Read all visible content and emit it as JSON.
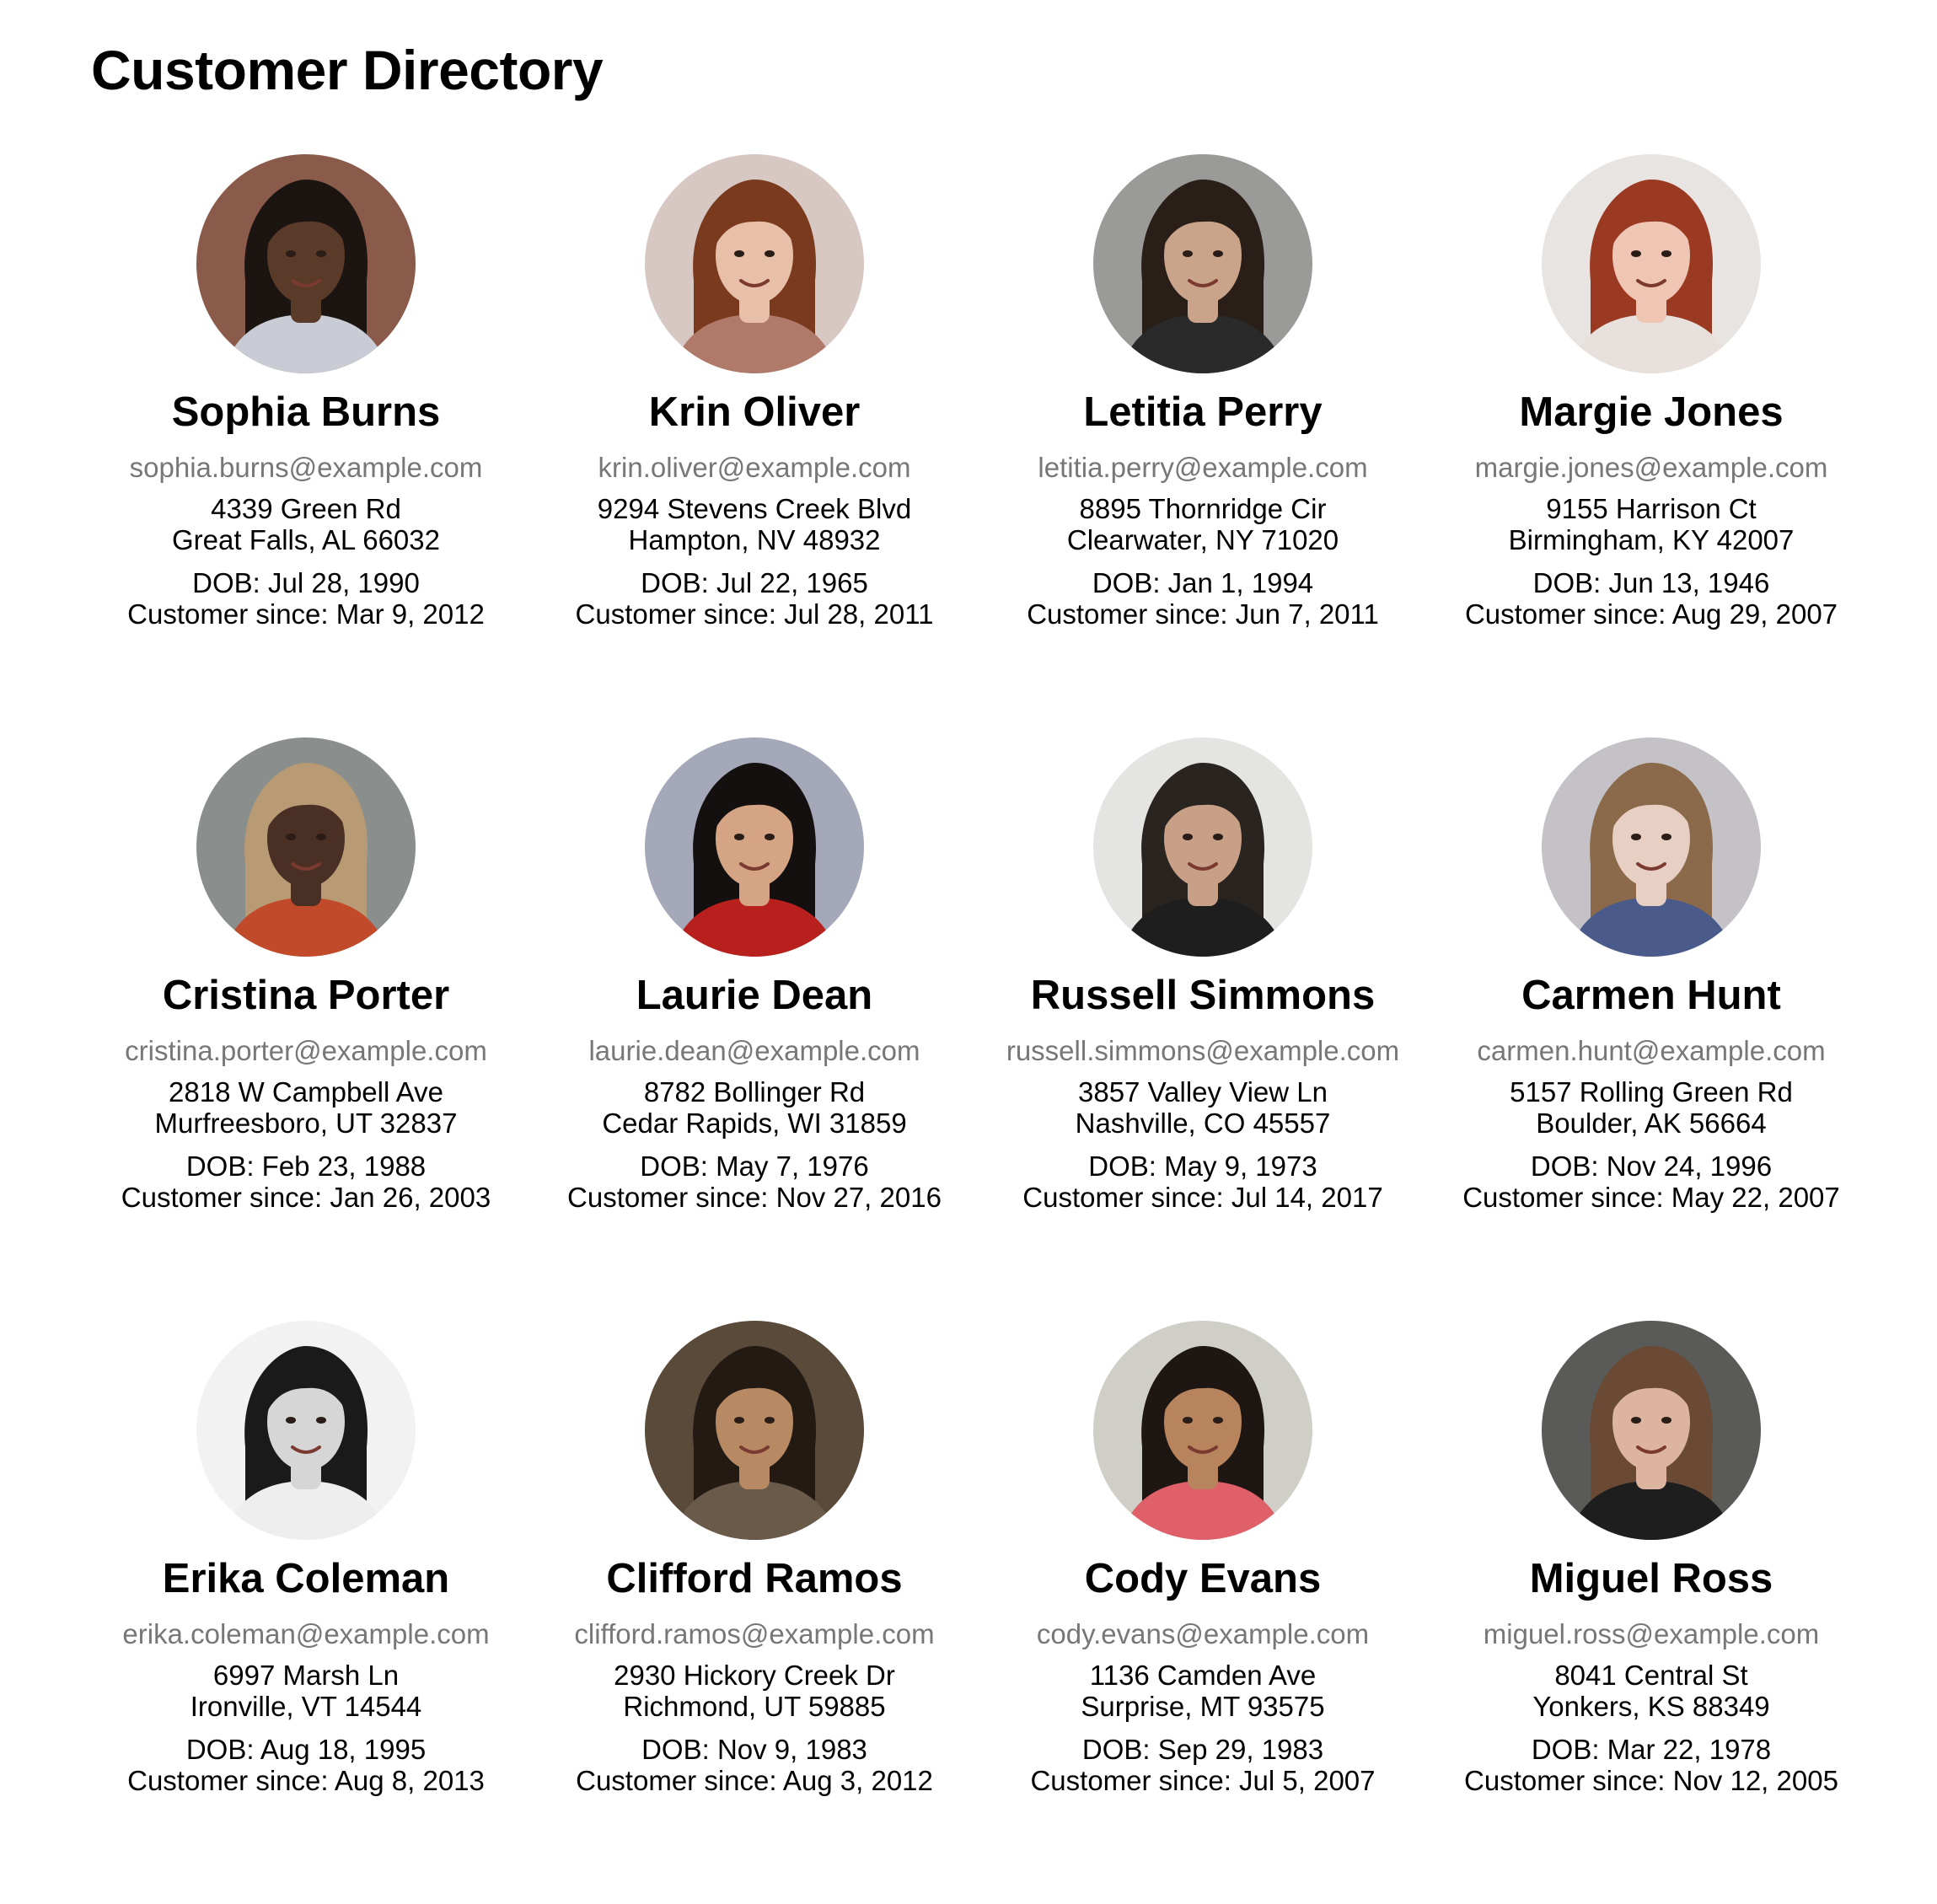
{
  "page": {
    "title": "Customer Directory"
  },
  "customers": [
    {
      "name": "Sophia Burns",
      "email": "sophia.burns@example.com",
      "street": "4339 Green Rd",
      "city": "Great Falls, AL 66032",
      "dob": "DOB: Jul 28, 1990",
      "since": "Customer since: Mar 9, 2012",
      "avatar": {
        "bg": "#8a5a4a",
        "skin": "#5a3a28",
        "hair": "#1c1410",
        "shirt": "#c9ccd4"
      }
    },
    {
      "name": "Krin Oliver",
      "email": "krin.oliver@example.com",
      "street": "9294 Stevens Creek Blvd",
      "city": "Hampton, NV 48932",
      "dob": "DOB: Jul 22, 1965",
      "since": "Customer since: Jul 28, 2011",
      "avatar": {
        "bg": "#d8c8c4",
        "skin": "#e8bfa8",
        "hair": "#7a3a1e",
        "shirt": "#b07a6a"
      }
    },
    {
      "name": "Letitia Perry",
      "email": "letitia.perry@example.com",
      "street": "8895 Thornridge Cir",
      "city": "Clearwater, NY 71020",
      "dob": "DOB: Jan 1, 1994",
      "since": "Customer since: Jun 7, 2011",
      "avatar": {
        "bg": "#9a9a98",
        "skin": "#caa48a",
        "hair": "#2a1e18",
        "shirt": "#2a2a2a"
      }
    },
    {
      "name": "Margie Jones",
      "email": "margie.jones@example.com",
      "street": "9155 Harrison Ct",
      "city": "Birmingham, KY 42007",
      "dob": "DOB: Jun 13, 1946",
      "since": "Customer since: Aug 29, 2007",
      "avatar": {
        "bg": "#e8e4e2",
        "skin": "#efc6b4",
        "hair": "#9a3a22",
        "shirt": "#e8e0dc"
      }
    },
    {
      "name": "Cristina Porter",
      "email": "cristina.porter@example.com",
      "street": "2818 W Campbell Ave",
      "city": "Murfreesboro, UT 32837",
      "dob": "DOB: Feb 23, 1988",
      "since": "Customer since: Jan 26, 2003",
      "avatar": {
        "bg": "#8a8e8c",
        "skin": "#4a3024",
        "hair": "#b89a74",
        "shirt": "#c04a2a"
      }
    },
    {
      "name": "Laurie Dean",
      "email": "laurie.dean@example.com",
      "street": "8782 Bollinger Rd",
      "city": "Cedar Rapids, WI 31859",
      "dob": "DOB: May 7, 1976",
      "since": "Customer since: Nov 27, 2016",
      "avatar": {
        "bg": "#a4a8b8",
        "skin": "#d4a484",
        "hair": "#141010",
        "shirt": "#b8201e"
      }
    },
    {
      "name": "Russell Simmons",
      "email": "russell.simmons@example.com",
      "street": "3857 Valley View Ln",
      "city": "Nashville, CO 45557",
      "dob": "DOB: May 9, 1973",
      "since": "Customer since: Jul 14, 2017",
      "avatar": {
        "bg": "#e4e4e2",
        "skin": "#c8a088",
        "hair": "#2a2420",
        "shirt": "#1e1e1e"
      }
    },
    {
      "name": "Carmen Hunt",
      "email": "carmen.hunt@example.com",
      "street": "5157 Rolling Green Rd",
      "city": "Boulder, AK 56664",
      "dob": "DOB: Nov 24, 1996",
      "since": "Customer since: May 22, 2007",
      "avatar": {
        "bg": "#c4c2c6",
        "skin": "#e8cfc4",
        "hair": "#8a6a4a",
        "shirt": "#4a5a8a"
      }
    },
    {
      "name": "Erika Coleman",
      "email": "erika.coleman@example.com",
      "street": "6997 Marsh Ln",
      "city": "Ironville, VT 14544",
      "dob": "DOB: Aug 18, 1995",
      "since": "Customer since: Aug 8, 2013",
      "avatar": {
        "bg": "#f2f2f2",
        "skin": "#d6d6d6",
        "hair": "#1a1a1a",
        "shirt": "#eeeeee"
      }
    },
    {
      "name": "Clifford Ramos",
      "email": "clifford.ramos@example.com",
      "street": "2930 Hickory Creek Dr",
      "city": "Richmond, UT 59885",
      "dob": "DOB: Nov 9, 1983",
      "since": "Customer since: Aug 3, 2012",
      "avatar": {
        "bg": "#5a4a3a",
        "skin": "#b88a64",
        "hair": "#241a14",
        "shirt": "#6a5a4a"
      }
    },
    {
      "name": "Cody Evans",
      "email": "cody.evans@example.com",
      "street": "1136 Camden Ave",
      "city": "Surprise, MT 93575",
      "dob": "DOB: Sep 29, 1983",
      "since": "Customer since: Jul 5, 2007",
      "avatar": {
        "bg": "#cfcfc8",
        "skin": "#b8845e",
        "hair": "#1e1612",
        "shirt": "#e0606a"
      }
    },
    {
      "name": "Miguel Ross",
      "email": "miguel.ross@example.com",
      "street": "8041 Central St",
      "city": "Yonkers, KS 88349",
      "dob": "DOB: Mar 22, 1978",
      "since": "Customer since: Nov 12, 2005",
      "avatar": {
        "bg": "#5a5a58",
        "skin": "#dcb4a0",
        "hair": "#6a4a34",
        "shirt": "#1e1e1e"
      }
    }
  ]
}
